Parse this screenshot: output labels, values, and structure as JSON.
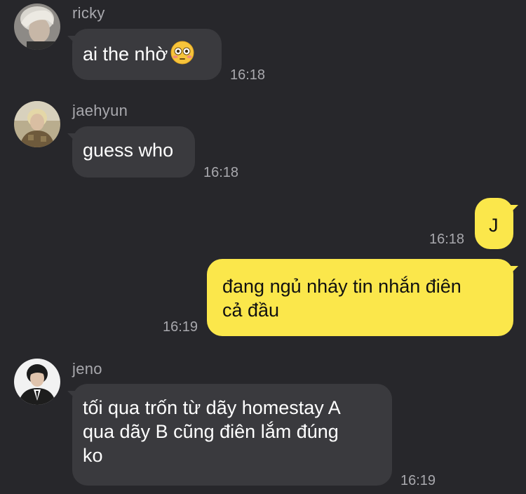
{
  "messages": [
    {
      "sender": "ricky",
      "avatar_icon": "ricky-avatar-photo",
      "text": "ai the nhờ",
      "emoji": "flushed-face-emoji",
      "time": "16:18"
    },
    {
      "sender": "jaehyun",
      "avatar_icon": "jaehyun-avatar-photo",
      "text": "guess who",
      "time": "16:18"
    },
    {
      "sender": "me",
      "text": "J",
      "time": "16:18"
    },
    {
      "sender": "me",
      "text_line1": "đang ngủ nháy tin nhắn điên",
      "text_line2": "cả đầu",
      "time": "16:19"
    },
    {
      "sender": "jeno",
      "avatar_icon": "jeno-avatar-photo",
      "text_line1": "tối qua trốn từ dãy homestay A",
      "text_line2": "qua dãy B cũng điên lắm đúng",
      "text_line3": "ko",
      "time": "16:19"
    }
  ],
  "colors": {
    "background": "#27272b",
    "incoming_bubble": "#3a3a3e",
    "outgoing_bubble": "#fbe74b",
    "meta_text": "#a8a8ad"
  }
}
